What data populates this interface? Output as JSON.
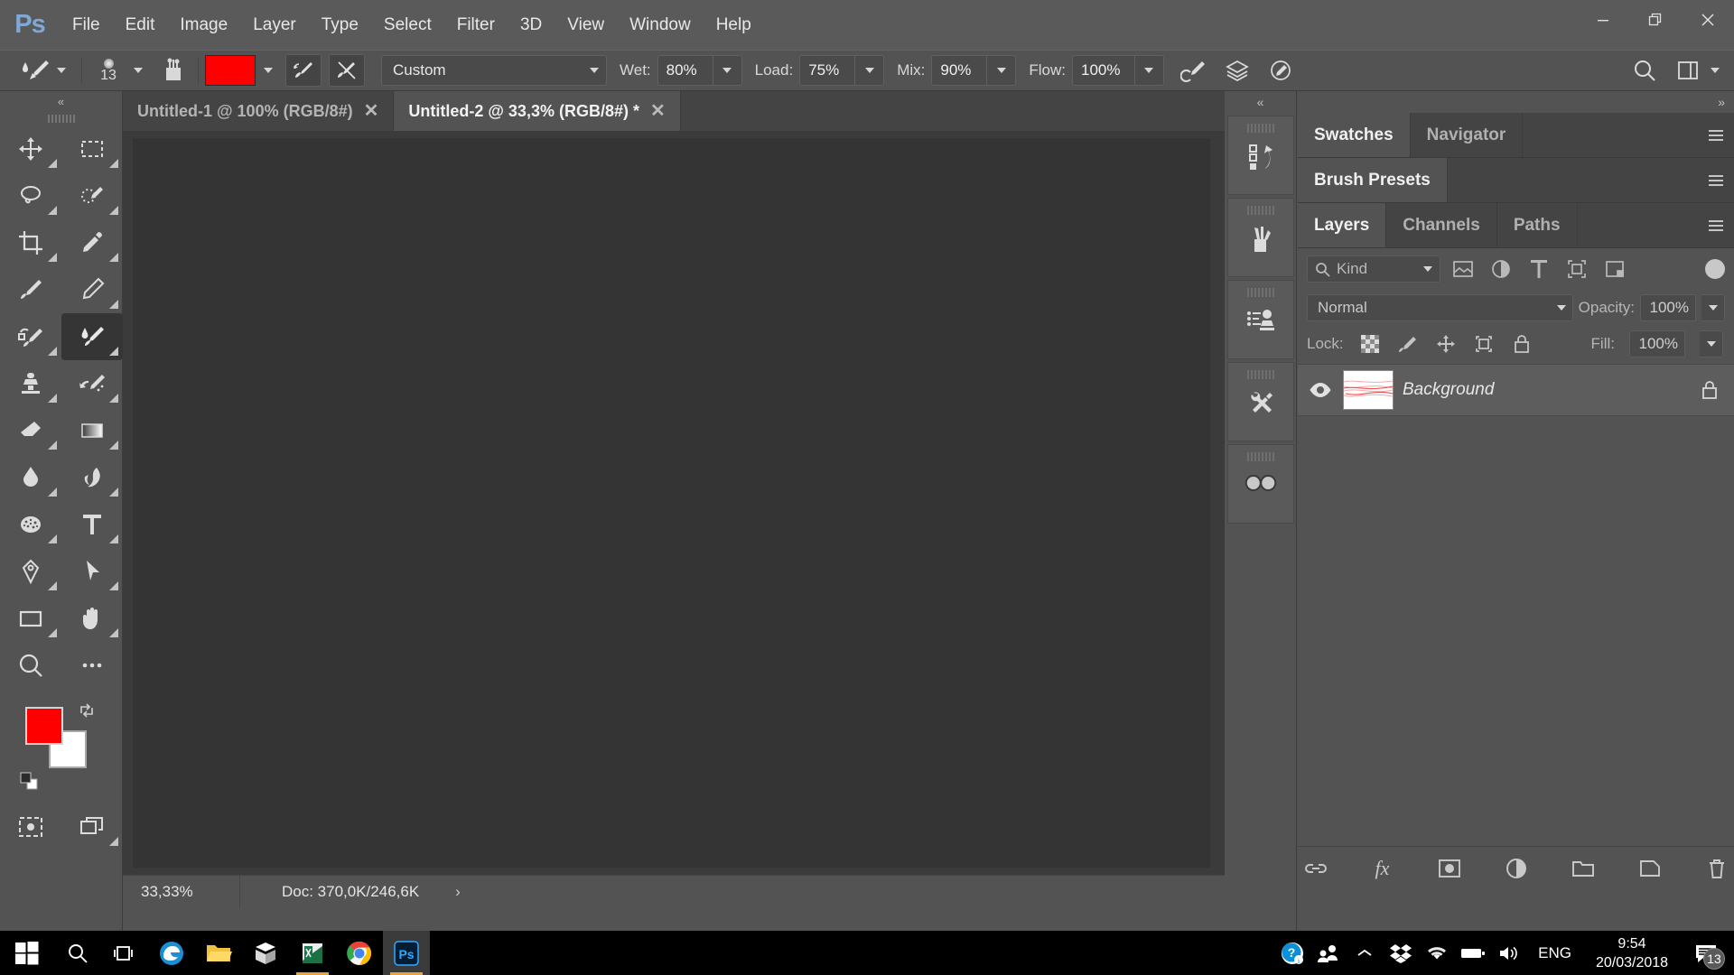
{
  "app": {
    "name": "Ps",
    "logo_color": "#7fa9d4"
  },
  "menubar": {
    "items": [
      "File",
      "Edit",
      "Image",
      "Layer",
      "Type",
      "Select",
      "Filter",
      "3D",
      "View",
      "Window",
      "Help"
    ]
  },
  "window_controls": {
    "minimize": "–",
    "restore": "❐",
    "close": "✕"
  },
  "options_bar": {
    "tool_preset_icon": "mixer-brush-icon",
    "brush_size": "13",
    "brush_panel_icon": "brush-presets-icon",
    "color_swatch": "#ff0000",
    "load_brush_icon": "load-brush-icon",
    "clean_brush_icon": "clean-brush-icon",
    "preset_label": "Custom",
    "wet_label": "Wet:",
    "wet_value": "80%",
    "load_label": "Load:",
    "load_value": "75%",
    "mix_label": "Mix:",
    "mix_value": "90%",
    "flow_label": "Flow:",
    "flow_value": "100%",
    "airbrush_icon": "airbrush-icon",
    "sample_all_layers_icon": "sample-all-layers-icon",
    "pressure_icon": "tablet-pressure-icon",
    "search_icon": "search-icon",
    "workspace_icon": "workspace-icon"
  },
  "toolbar": {
    "collapse": "«",
    "tools": [
      {
        "name": "move-tool",
        "icon": "move-icon",
        "has_flyout": true
      },
      {
        "name": "marquee-tool",
        "icon": "rectangular-marquee-icon",
        "has_flyout": true
      },
      {
        "name": "lasso-tool",
        "icon": "lasso-icon",
        "has_flyout": true
      },
      {
        "name": "quick-selection-tool",
        "icon": "quick-selection-icon",
        "has_flyout": true
      },
      {
        "name": "crop-tool",
        "icon": "crop-icon",
        "has_flyout": true
      },
      {
        "name": "eyedropper-tool",
        "icon": "eyedropper-icon",
        "has_flyout": true
      },
      {
        "name": "healing-brush-tool",
        "icon": "healing-brush-icon",
        "has_flyout": false
      },
      {
        "name": "pencil-tool",
        "icon": "pencil-icon",
        "has_flyout": true
      },
      {
        "name": "history-brush-tool",
        "icon": "history-brush-icon",
        "has_flyout": true
      },
      {
        "name": "mixer-brush-tool",
        "icon": "mixer-brush-icon",
        "has_flyout": true,
        "active": true
      },
      {
        "name": "clone-stamp-tool",
        "icon": "clone-stamp-icon",
        "has_flyout": true
      },
      {
        "name": "art-history-brush-tool",
        "icon": "art-history-brush-icon",
        "has_flyout": true
      },
      {
        "name": "eraser-tool",
        "icon": "eraser-icon",
        "has_flyout": true
      },
      {
        "name": "gradient-tool",
        "icon": "gradient-icon",
        "has_flyout": true
      },
      {
        "name": "blur-tool",
        "icon": "blur-drop-icon",
        "has_flyout": true
      },
      {
        "name": "dodge-tool",
        "icon": "dodge-burn-icon",
        "has_flyout": true
      },
      {
        "name": "sponge-tool",
        "icon": "sponge-icon",
        "has_flyout": true
      },
      {
        "name": "type-tool",
        "icon": "type-icon",
        "has_flyout": true
      },
      {
        "name": "pen-tool",
        "icon": "pen-icon",
        "has_flyout": true
      },
      {
        "name": "path-selection-tool",
        "icon": "path-selection-icon",
        "has_flyout": true
      },
      {
        "name": "rectangle-tool",
        "icon": "rectangle-shape-icon",
        "has_flyout": true
      },
      {
        "name": "hand-tool",
        "icon": "hand-icon",
        "has_flyout": true
      },
      {
        "name": "zoom-tool",
        "icon": "zoom-magnifier-icon",
        "has_flyout": false
      },
      {
        "name": "edit-toolbar-tool",
        "icon": "ellipsis-icon",
        "has_flyout": false
      }
    ],
    "foreground_color": "#ff0000",
    "background_color": "#ffffff",
    "swap_icon": "swap-colors-icon",
    "default_colors_icon": "default-colors-icon",
    "quick_mask_icon": "quick-mask-icon",
    "screen_mode_icon": "screen-mode-icon"
  },
  "document_tabs": [
    {
      "title": "Untitled-1 @ 100% (RGB/8#)",
      "active": false,
      "close": "✕"
    },
    {
      "title": "Untitled-2 @ 33,3% (RGB/8#) *",
      "active": true,
      "close": "✕"
    }
  ],
  "status_bar": {
    "zoom": "33,33%",
    "doc_info": "Doc: 370,0K/246,6K",
    "expand_arrow": "›"
  },
  "dock_rail": {
    "collapse": "«",
    "items": [
      {
        "name": "history-panel-icon"
      },
      {
        "name": "brush-presets-panel-icon"
      },
      {
        "name": "clone-source-panel-icon"
      },
      {
        "name": "tool-presets-panel-icon"
      },
      {
        "name": "creative-cloud-libraries-icon"
      }
    ]
  },
  "panels": {
    "collapse": "»",
    "group_top": {
      "tabs": [
        {
          "label": "Swatches",
          "active": true
        },
        {
          "label": "Navigator",
          "active": false
        }
      ]
    },
    "group_mid": {
      "tabs": [
        {
          "label": "Brush Presets",
          "active": true
        }
      ]
    },
    "layers": {
      "tabs": [
        {
          "label": "Layers",
          "active": true
        },
        {
          "label": "Channels",
          "active": false
        },
        {
          "label": "Paths",
          "active": false
        }
      ],
      "filter_label": "Kind",
      "filter_icons": [
        "filter-pixel-icon",
        "filter-adjustment-icon",
        "filter-type-icon",
        "filter-shape-icon",
        "filter-smart-object-icon"
      ],
      "filter_toggle": "filter-enable-toggle",
      "blend_mode": "Normal",
      "opacity_label": "Opacity:",
      "opacity_value": "100%",
      "lock_label": "Lock:",
      "lock_icons": [
        "lock-transparent-pixels-icon",
        "lock-image-pixels-icon",
        "lock-position-icon",
        "lock-artboard-icon",
        "lock-all-icon"
      ],
      "fill_label": "Fill:",
      "fill_value": "100%",
      "rows": [
        {
          "name": "Background",
          "visible": true,
          "locked": true,
          "thumb": "red-brush-strokes-on-white"
        }
      ],
      "footer_icons": [
        "link-layers-icon",
        "layer-style-fx-icon",
        "add-layer-mask-icon",
        "new-adjustment-layer-icon",
        "new-group-icon",
        "new-layer-icon",
        "delete-layer-icon"
      ],
      "fx_label": "fx"
    }
  },
  "taskbar": {
    "start_icon": "windows-start-icon",
    "search_icon": "search-icon",
    "task_view_icon": "task-view-icon",
    "apps": [
      {
        "name": "edge-browser",
        "icon": "edge-icon",
        "open": false
      },
      {
        "name": "file-explorer",
        "icon": "folder-icon",
        "open": false
      },
      {
        "name": "store-app",
        "icon": "store-icon",
        "open": false
      },
      {
        "name": "excel-app",
        "icon": "excel-icon",
        "open": true
      },
      {
        "name": "chrome-browser",
        "icon": "chrome-icon",
        "open": false
      },
      {
        "name": "photoshop-app",
        "icon": "photoshop-icon",
        "open": true,
        "active": true
      }
    ],
    "tray": {
      "help_icon": "help-question-icon",
      "people_icon": "people-icon",
      "chevron_icon": "show-hidden-icons-chevron",
      "dropbox_icon": "dropbox-icon",
      "wifi_icon": "wifi-icon",
      "battery_icon": "battery-icon",
      "volume_icon": "volume-icon",
      "language": "ENG",
      "time": "9:54",
      "date": "20/03/2018",
      "notification_icon": "action-center-icon",
      "notification_count": "13"
    }
  }
}
